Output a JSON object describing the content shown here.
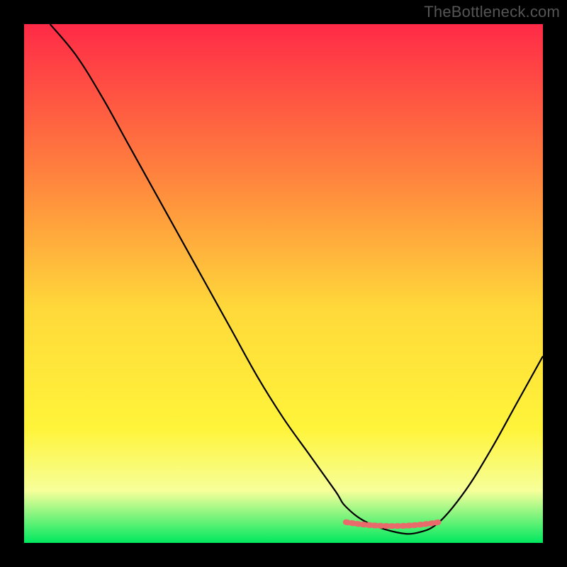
{
  "watermark": "TheBottleneck.com",
  "colors": {
    "frame": "#000000",
    "curve": "#000000",
    "highlight": "#e96a6a",
    "gradient_top": "#ff2a47",
    "gradient_mid_upper": "#ff7f3e",
    "gradient_mid": "#ffd93a",
    "gradient_mid_lower": "#fff43a",
    "gradient_low": "#f6ff9a",
    "gradient_bottom": "#00e85e"
  },
  "chart_data": {
    "type": "line",
    "title": "",
    "xlabel": "",
    "ylabel": "",
    "xlim": [
      0,
      100
    ],
    "ylim": [
      0,
      100
    ],
    "series": [
      {
        "name": "curve",
        "x": [
          5,
          10,
          15,
          20,
          25,
          30,
          35,
          40,
          45,
          50,
          55,
          60,
          62,
          66,
          72,
          76,
          80,
          85,
          90,
          95,
          100
        ],
        "y": [
          100,
          94,
          86,
          77,
          68,
          59,
          50,
          41,
          32,
          24,
          17,
          10,
          7,
          4,
          2,
          2,
          4,
          10,
          18,
          27,
          36
        ]
      },
      {
        "name": "optimal-range",
        "x": [
          62,
          80
        ],
        "y": [
          4,
          4
        ]
      }
    ],
    "annotations": []
  }
}
